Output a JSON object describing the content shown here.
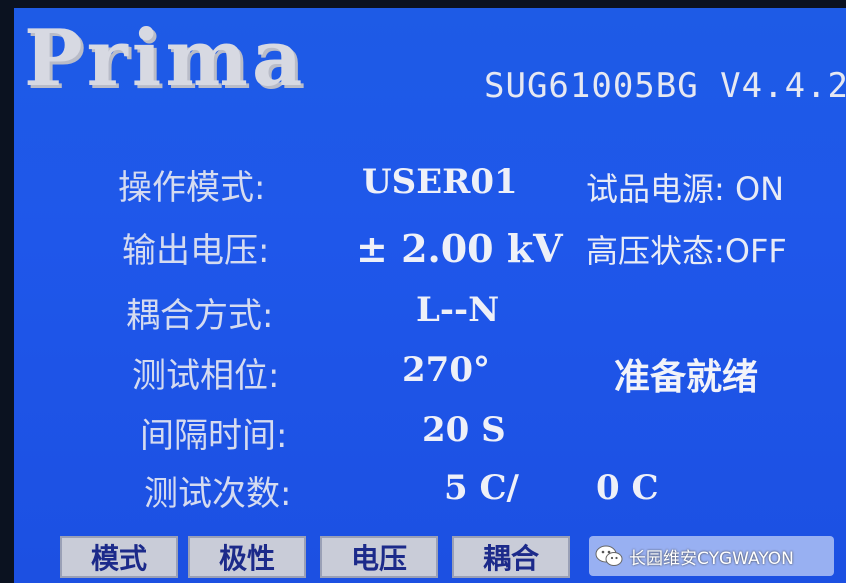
{
  "header": {
    "logo": "Prima",
    "model": "SUG61005BG V4.4.2"
  },
  "fields": {
    "mode_label": "操作模式:",
    "mode_value": "USER01",
    "voltage_label": "输出电压:",
    "voltage_value": "± 2.00 kV",
    "coupling_label": "耦合方式:",
    "coupling_value": "L--N",
    "phase_label": "测试相位:",
    "phase_value": "270°",
    "interval_label": "间隔时间:",
    "interval_value": "20 S",
    "count_label": "测试次数:",
    "count_value": "5 C/",
    "count_done": "0 C"
  },
  "status": {
    "eut_power": "试品电源: ON",
    "hv_state": "高压状态:OFF",
    "ready": "准备就绪"
  },
  "softkeys": {
    "mode": "模式",
    "polarity": "极性",
    "voltage": "电压",
    "coupling": "耦合"
  },
  "watermark": {
    "text": "长园维安CYGWAYON",
    "icon": "wechat-icon"
  },
  "colors": {
    "screen_blue": "#1e5be6",
    "softkey_bg": "#c9ccd8",
    "softkey_text": "#1c2a8a"
  }
}
